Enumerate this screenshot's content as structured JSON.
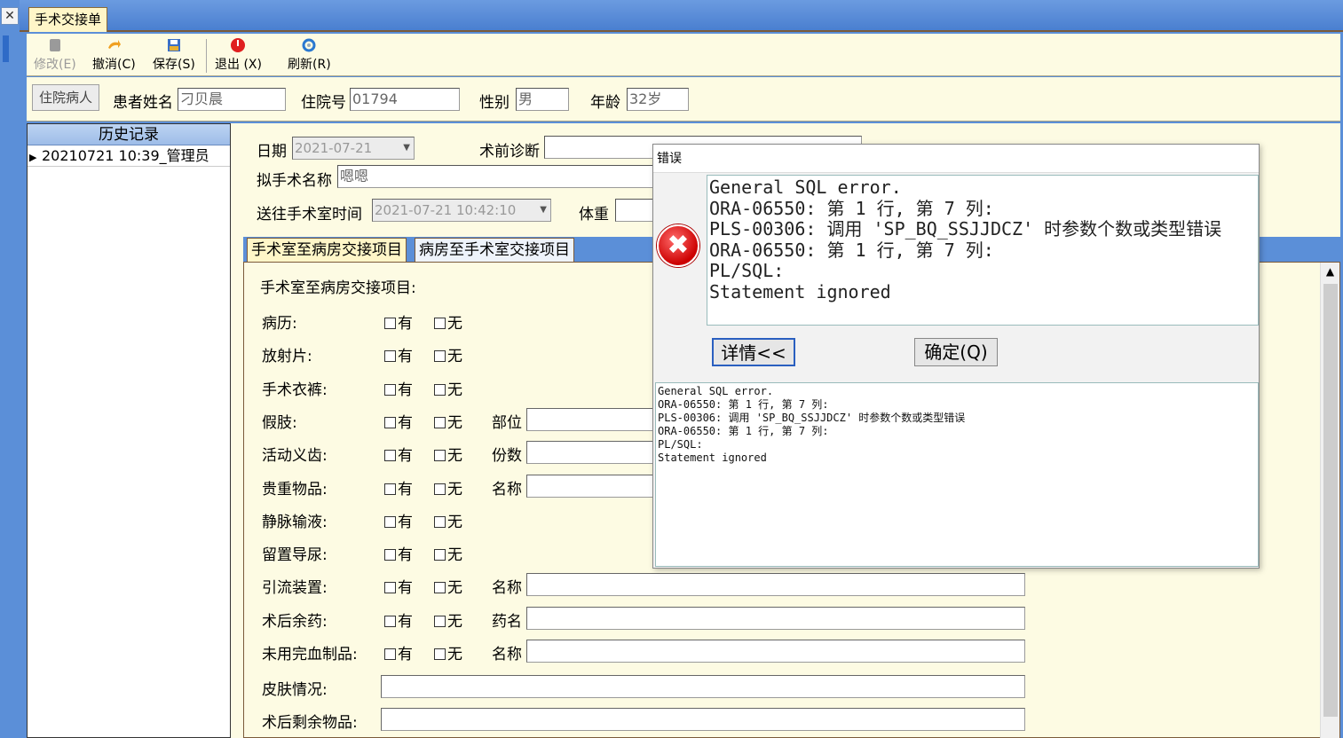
{
  "window": {
    "close_glyph": "✕",
    "tab_title": "手术交接单"
  },
  "toolbar": {
    "modify": "修改(E)",
    "undo": "撤消(C)",
    "save": "保存(S)",
    "exit": "退出 (X)",
    "refresh": "刷新(R)"
  },
  "patient": {
    "inpatient_button": "住院病人",
    "name_label": "患者姓名",
    "name_value": "刁贝晨",
    "admission_label": "住院号",
    "admission_value": "01794",
    "gender_label": "性别",
    "gender_value": "男",
    "age_label": "年龄",
    "age_value": "32岁"
  },
  "history": {
    "header": "历史记录",
    "rows": [
      "20210721 10:39_管理员"
    ]
  },
  "form": {
    "date_label": "日期",
    "date_value": "2021-07-21",
    "prediag_label": "术前诊断",
    "surgery_name_label": "拟手术名称",
    "surgery_name_value": "嗯嗯",
    "send_time_label": "送往手术室时间",
    "send_time_value": "2021-07-21 10:42:10",
    "weight_label": "体重"
  },
  "tabs": [
    {
      "label": "手术室至病房交接项目",
      "active": true
    },
    {
      "label": "病房至手术室交接项目",
      "active": false
    }
  ],
  "panel": {
    "title": "手术室至病房交接项目:",
    "yes": "有",
    "no": "无",
    "items": [
      {
        "name": "病历:",
        "sub": ""
      },
      {
        "name": "放射片:",
        "sub": ""
      },
      {
        "name": "手术衣裤:",
        "sub": ""
      },
      {
        "name": "假肢:",
        "sub": "部位"
      },
      {
        "name": "活动义齿:",
        "sub": "份数"
      },
      {
        "name": "贵重物品:",
        "sub": "名称"
      },
      {
        "name": "静脉输液:",
        "sub": ""
      },
      {
        "name": "留置导尿:",
        "sub": ""
      },
      {
        "name": "引流装置:",
        "sub": "名称"
      },
      {
        "name": "术后余药:",
        "sub": "药名"
      },
      {
        "name": "未用完血制品:",
        "sub": "名称"
      }
    ],
    "skin_label": "皮肤情况:",
    "remaining_label": "术后剩余物品:"
  },
  "dialog": {
    "title": "错误",
    "icon": "error-icon",
    "message": "General SQL error.\nORA-06550: 第 1 行, 第 7 列:\nPLS-00306: 调用 'SP_BQ_SSJJDCZ' 时参数个数或类型错误\nORA-06550: 第 1 行, 第 7 列:\nPL/SQL:\nStatement ignored",
    "details_button": "详情<<",
    "ok_button": "确定(Q)",
    "detail_text": "General SQL error.\nORA-06550: 第 1 行, 第 7 列:\nPLS-00306: 调用 'SP_BQ_SSJJDCZ' 时参数个数或类型错误\nORA-06550: 第 1 行, 第 7 列:\nPL/SQL:\nStatement ignored"
  }
}
